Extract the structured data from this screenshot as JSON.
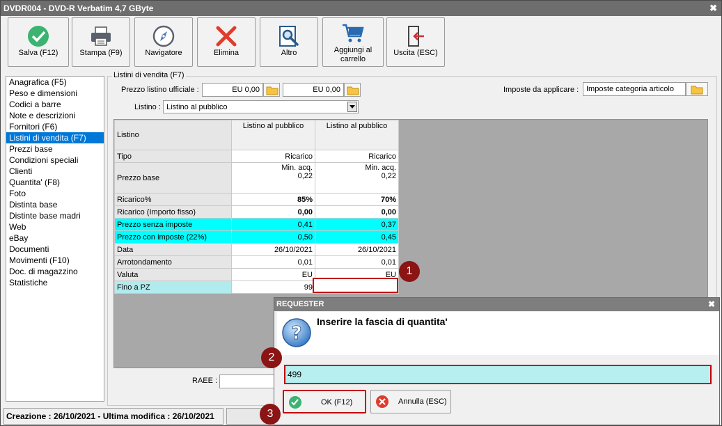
{
  "window": {
    "title": "DVDR004 - DVD-R Verbatim 4,7 GByte",
    "close_glyph": "✖"
  },
  "toolbar": [
    {
      "label": "Salva (F12)",
      "icon": "check-icon"
    },
    {
      "label": "Stampa (F9)",
      "icon": "printer-icon"
    },
    {
      "label": "Navigatore",
      "icon": "compass-icon"
    },
    {
      "label": "Elimina",
      "icon": "delete-x-icon"
    },
    {
      "label": "Altro",
      "icon": "search-doc-icon"
    },
    {
      "label": "Aggiungi al carrello",
      "icon": "cart-icon"
    },
    {
      "label": "Uscita (ESC)",
      "icon": "exit-icon"
    }
  ],
  "sidebar": {
    "selected_index": 5,
    "items": [
      "Anagrafica (F5)",
      "Peso e dimensioni",
      "Codici a barre",
      "Note e descrizioni",
      "Fornitori (F6)",
      "Listini di vendita (F7)",
      "Prezzi base",
      "Condizioni speciali",
      "Clienti",
      "Quantita' (F8)",
      "Foto",
      "Distinta base",
      "Distinte base madri",
      "Web",
      "eBay",
      "Documenti",
      "Movimenti (F10)",
      "Doc. di magazzino",
      "Statistiche"
    ]
  },
  "panel": {
    "legend": "Listini di vendita (F7)",
    "prezzo_label": "Prezzo listino ufficiale :",
    "prezzo_value_1": "EU 0,00",
    "prezzo_value_2": "EU 0,00",
    "imposte_label": "Imposte da applicare :",
    "imposte_value": "Imposte categoria articolo",
    "listino_label": "Listino :",
    "listino_value": "Listino al pubblico",
    "raee_label": "RAEE :"
  },
  "grid": {
    "header": {
      "label": "Listino",
      "col1": "Listino al pubblico",
      "col2": "Listino al pubblico"
    },
    "tipo": {
      "label": "Tipo",
      "c1": "Ricarico",
      "c2": "Ricarico"
    },
    "prezzo_base": {
      "label": "Prezzo base",
      "c1a": "Min. acq.",
      "c1b": "0,22",
      "c2a": "Min. acq.",
      "c2b": "0,22"
    },
    "ricarico_pct": {
      "label": "Ricarico%",
      "c1": "85%",
      "c2": "70%"
    },
    "ricarico_fisso": {
      "label": "Ricarico (Importo fisso)",
      "c1": "0,00",
      "c2": "0,00"
    },
    "prezzo_senza": {
      "label": "Prezzo senza imposte",
      "c1": "0,41",
      "c2": "0,37"
    },
    "prezzo_con": {
      "label": "Prezzo con imposte (22%)",
      "c1": "0,50",
      "c2": "0,45"
    },
    "data": {
      "label": "Data",
      "c1": "26/10/2021",
      "c2": "26/10/2021"
    },
    "arrotondamento": {
      "label": "Arrotondamento",
      "c1": "0,01",
      "c2": "0,01"
    },
    "valuta": {
      "label": "Valuta",
      "c1": "EU",
      "c2": "EU"
    },
    "fino": {
      "label": "Fino a PZ",
      "c1": "99",
      "c2": ""
    }
  },
  "status": {
    "text": "Creazione : 26/10/2021 - Ultima modifica : 26/10/2021"
  },
  "badges": [
    "1",
    "2",
    "3"
  ],
  "dialog": {
    "title": "REQUESTER",
    "close_glyph": "✖",
    "message": "Inserire la fascia di quantita'",
    "input_value": "499",
    "ok_label": "OK (F12)",
    "cancel_label": "Annulla (ESC)"
  },
  "colors": {
    "highlight_red": "#c00000",
    "badge": "#8b1414",
    "cyan": "#00ffff",
    "selection": "#0078d7"
  }
}
